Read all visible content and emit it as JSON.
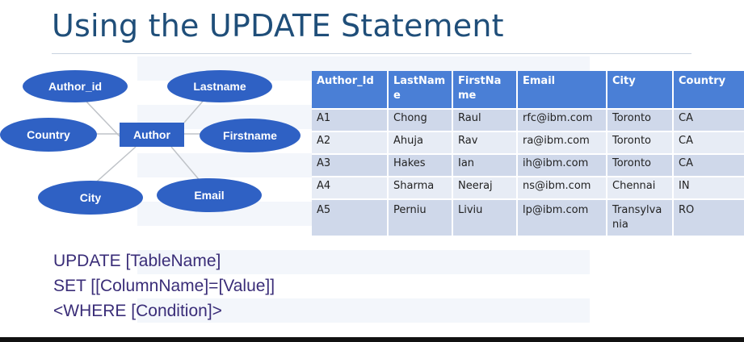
{
  "slide": {
    "title": "Using the UPDATE Statement"
  },
  "er_diagram": {
    "entity": "Author",
    "attributes": {
      "author_id": "Author_id",
      "lastname": "Lastname",
      "country": "Country",
      "firstname": "Firstname",
      "city": "City",
      "email": "Email"
    }
  },
  "table": {
    "headers": [
      "Author_Id",
      "LastName",
      "FirstName",
      "Email",
      "City",
      "Country"
    ],
    "rows": [
      [
        "A1",
        "Chong",
        "Raul",
        "rfc@ibm.com",
        "Toronto",
        "CA"
      ],
      [
        "A2",
        "Ahuja",
        "Rav",
        "ra@ibm.com",
        "Toronto",
        "CA"
      ],
      [
        "A3",
        "Hakes",
        "Ian",
        "ih@ibm.com",
        "Toronto",
        "CA"
      ],
      [
        "A4",
        "Sharma",
        "Neeraj",
        "ns@ibm.com",
        "Chennai",
        "IN"
      ],
      [
        "A5",
        "Perniu",
        "Liviu",
        "lp@ibm.com",
        "Transylvania",
        "RO"
      ]
    ]
  },
  "syntax": {
    "line1": "UPDATE [TableName]",
    "line2": "SET [[ColumnName]=[Value]]",
    "line3": "<WHERE [Condition]>"
  },
  "colors": {
    "title": "#1f4e79",
    "shape_fill": "#2f61c4",
    "table_header": "#4a7fd6",
    "row_odd": "#cfd8ea",
    "row_even": "#e7ecf5",
    "code_text": "#3a2d78"
  }
}
